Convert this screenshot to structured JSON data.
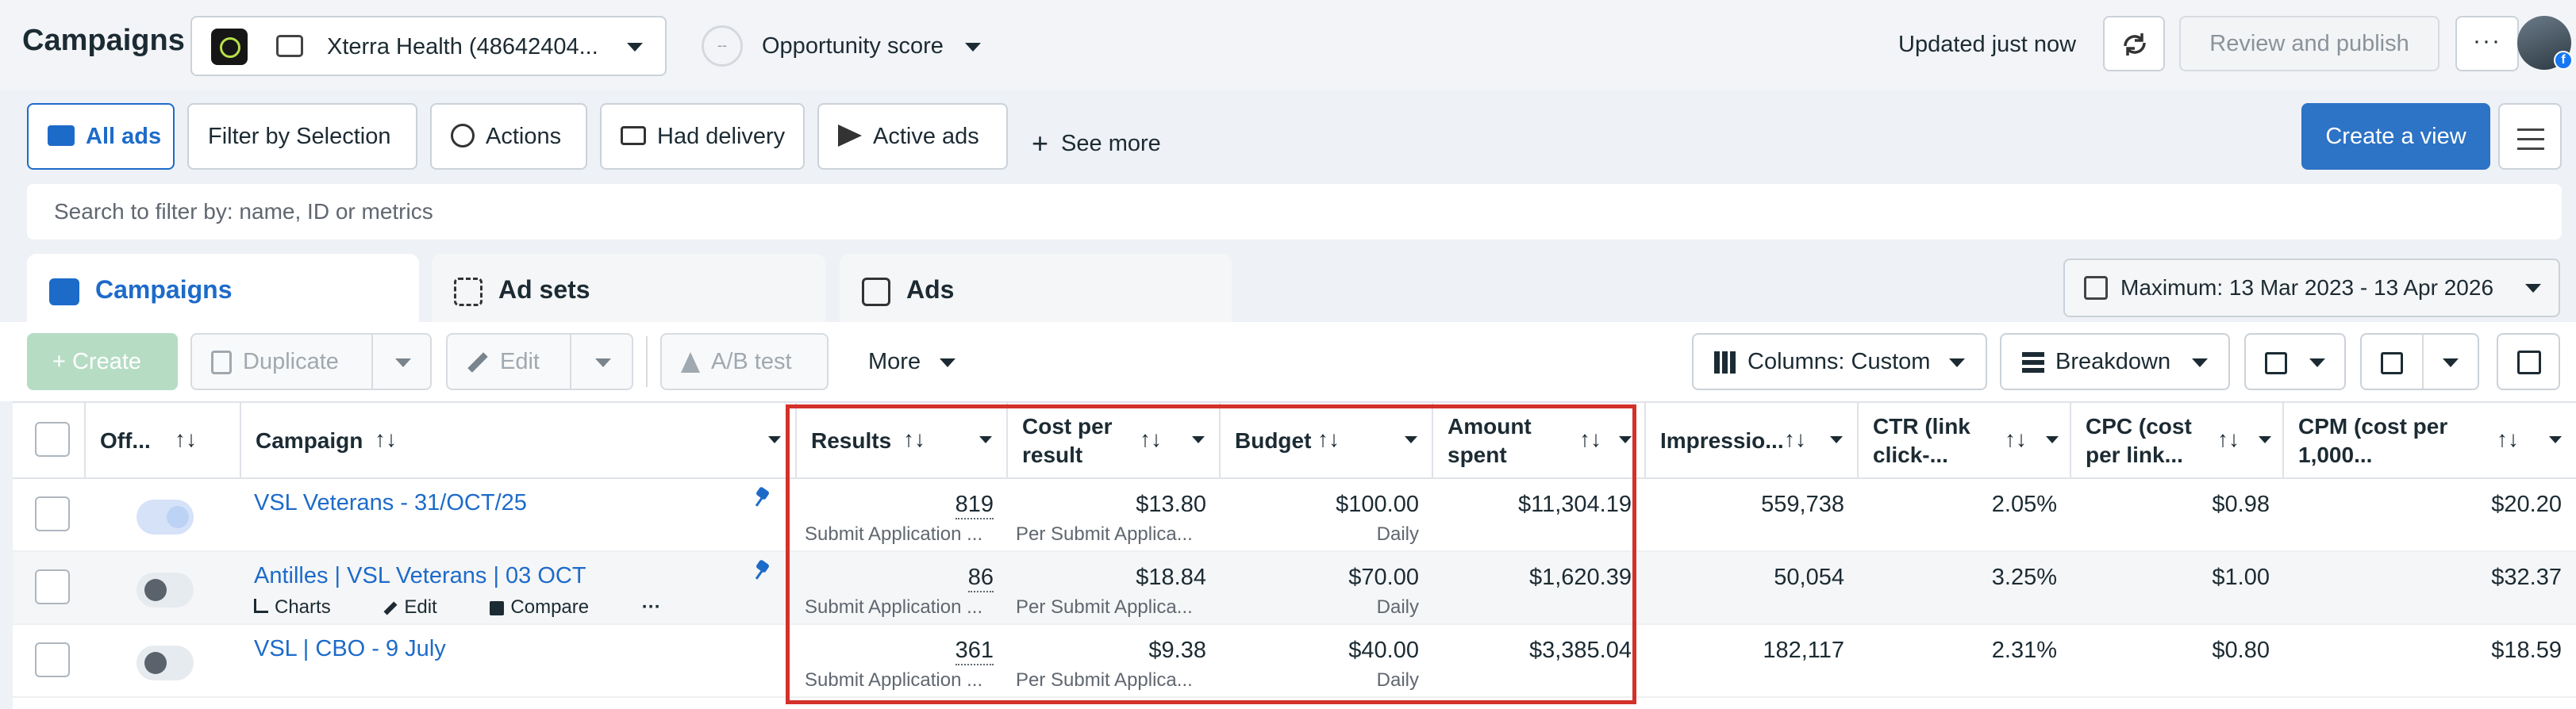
{
  "header": {
    "title": "Campaigns",
    "account_name": "Xterra Health (48642404...",
    "opportunity_ring": "--",
    "opportunity_label": "Opportunity score",
    "updated": "Updated just now",
    "review_label": "Review and publish",
    "more_label": "···"
  },
  "filters": {
    "all_ads": "All ads",
    "filter_by_selection": "Filter by Selection",
    "actions": "Actions",
    "had_delivery": "Had delivery",
    "active_ads": "Active ads",
    "see_more": "See more",
    "create_view": "Create a view"
  },
  "search": {
    "placeholder": "Search to filter by: name, ID or metrics"
  },
  "tabs": {
    "campaigns": "Campaigns",
    "ad_sets": "Ad sets",
    "ads": "Ads"
  },
  "date_range": "Maximum: 13 Mar 2023 - 13 Apr 2026",
  "toolbar": {
    "create": "+ Create",
    "duplicate": "Duplicate",
    "edit": "Edit",
    "ab_test": "A/B test",
    "more": "More",
    "columns": "Columns: Custom",
    "breakdown": "Breakdown"
  },
  "table": {
    "headers": {
      "off_on": "Off...",
      "campaign": "Campaign",
      "results": "Results",
      "cost_per_result_1": "Cost per",
      "cost_per_result_2": "result",
      "budget": "Budget",
      "amount_spent_1": "Amount",
      "amount_spent_2": "spent",
      "impressions": "Impressio...",
      "ctr_1": "CTR (link",
      "ctr_2": "click-...",
      "cpc_1": "CPC (cost",
      "cpc_2": "per link...",
      "cpm_1": "CPM (cost per",
      "cpm_2": "1,000..."
    },
    "sort_glyph": "↑↓",
    "row_actions": {
      "charts": "Charts",
      "edit": "Edit",
      "compare": "Compare",
      "more": "···"
    },
    "rows": [
      {
        "name": "VSL Veterans - 31/OCT/25",
        "toggle_on": true,
        "results": "819",
        "results_sub": "Submit Application ...",
        "cost_per_result": "$13.80",
        "cost_sub": "Per Submit Applica...",
        "budget": "$100.00",
        "budget_sub": "Daily",
        "amount_spent": "$11,304.19",
        "impressions": "559,738",
        "ctr": "2.05%",
        "cpc": "$0.98",
        "cpm": "$20.20"
      },
      {
        "name": "Antilles | VSL Veterans | 03 OCT",
        "toggle_on": false,
        "results": "86",
        "results_sub": "Submit Application ...",
        "cost_per_result": "$18.84",
        "cost_sub": "Per Submit Applica...",
        "budget": "$70.00",
        "budget_sub": "Daily",
        "amount_spent": "$1,620.39",
        "impressions": "50,054",
        "ctr": "3.25%",
        "cpc": "$1.00",
        "cpm": "$32.37"
      },
      {
        "name": "VSL | CBO - 9 July",
        "toggle_on": false,
        "results": "361",
        "results_sub": "Submit Application ...",
        "cost_per_result": "$9.38",
        "cost_sub": "Per Submit Applica...",
        "budget": "$40.00",
        "budget_sub": "Daily",
        "amount_spent": "$3,385.04",
        "impressions": "182,117",
        "ctr": "2.31%",
        "cpc": "$0.80",
        "cpm": "$18.59"
      }
    ]
  },
  "colors": {
    "accent": "#1d6bc9",
    "highlight": "#d3312a",
    "create_view": "#2d73c6"
  },
  "icons": [
    "account-logo-icon",
    "ad-account-icon",
    "refresh-icon",
    "facebook-badge-icon",
    "folder-icon",
    "actions-icon",
    "mail-icon",
    "send-icon",
    "plus-icon",
    "filter-settings-icon",
    "calendar-icon",
    "duplicate-icon",
    "pencil-icon",
    "flask-icon",
    "columns-icon",
    "breakdown-icon",
    "reports-icon",
    "export-icon",
    "chart-icon",
    "pin-icon"
  ]
}
